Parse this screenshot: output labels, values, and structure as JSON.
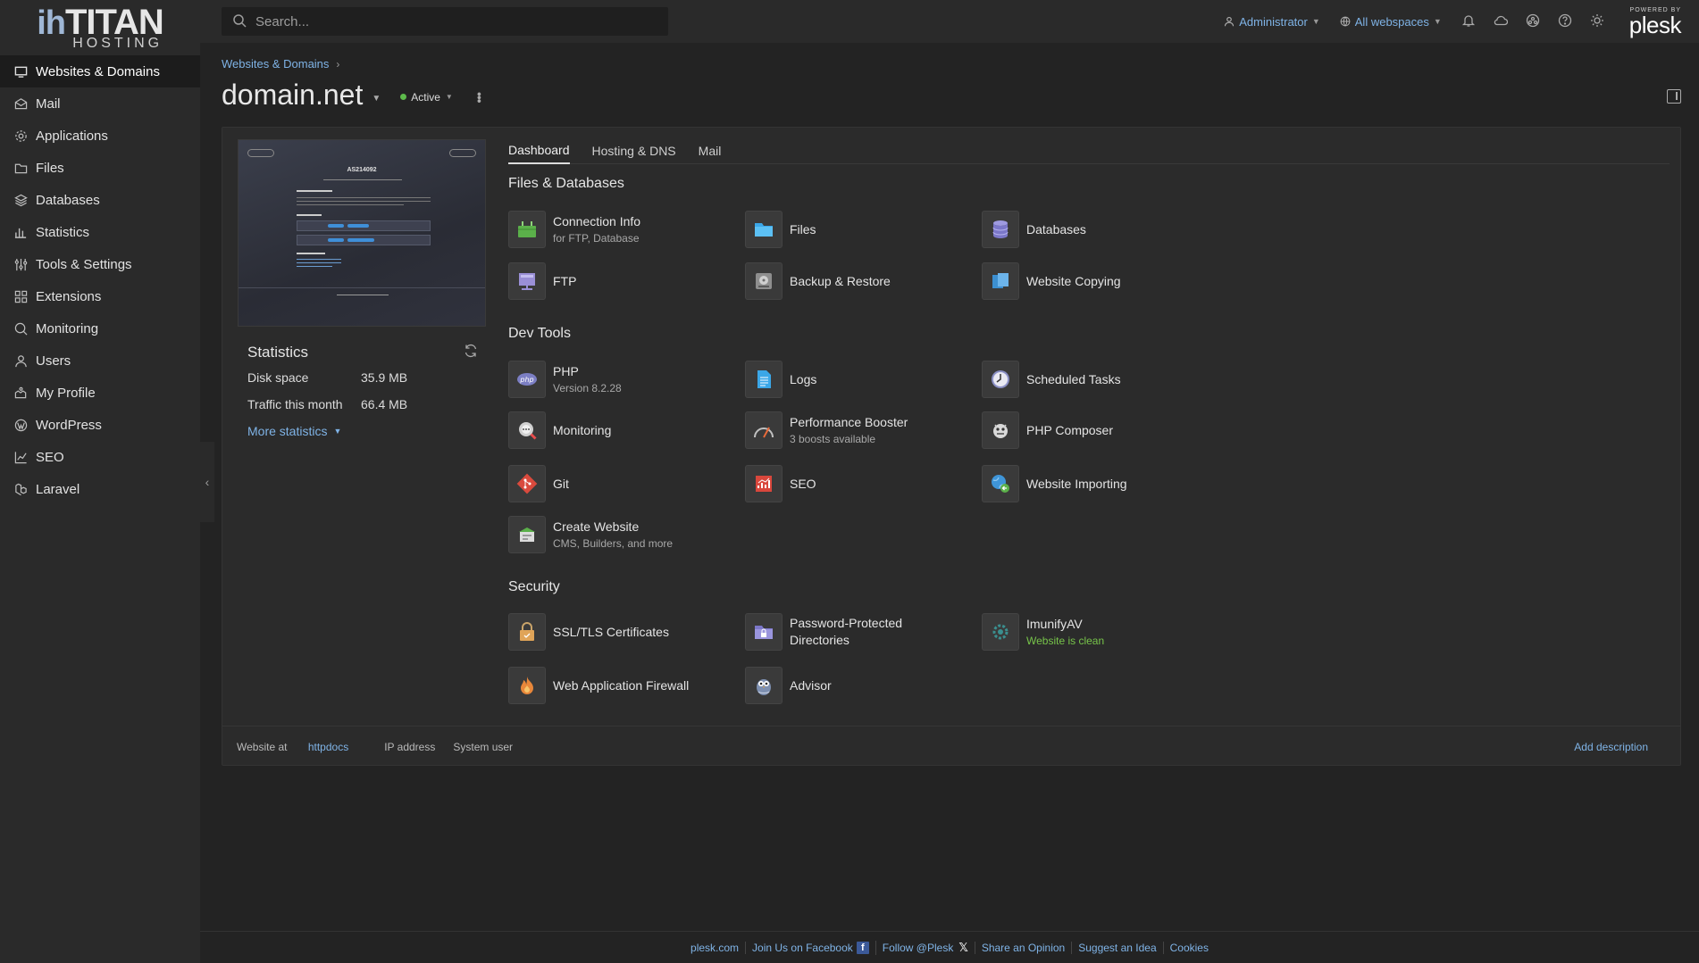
{
  "brand": {
    "logo_main": "ihTITAN",
    "logo_prefix": "ih",
    "logo_word": "TITAN",
    "logo_sub": "HOSTING"
  },
  "search": {
    "placeholder": "Search..."
  },
  "topbar": {
    "user": "Administrator",
    "webspaces": "All webspaces",
    "powered_by": "POWERED BY",
    "plesk": "plesk",
    "icons": [
      "notifications-icon",
      "cloud-icon",
      "community-icon",
      "help-icon",
      "theme-icon"
    ]
  },
  "sidebar": {
    "items": [
      {
        "label": "Websites & Domains",
        "icon": "monitor-icon"
      },
      {
        "label": "Mail",
        "icon": "mail-icon"
      },
      {
        "label": "Applications",
        "icon": "gear-icon"
      },
      {
        "label": "Files",
        "icon": "folder-icon"
      },
      {
        "label": "Databases",
        "icon": "layers-icon"
      },
      {
        "label": "Statistics",
        "icon": "bar-chart-icon"
      },
      {
        "label": "Tools & Settings",
        "icon": "sliders-icon"
      },
      {
        "label": "Extensions",
        "icon": "grid-icon"
      },
      {
        "label": "Monitoring",
        "icon": "monitoring-icon"
      },
      {
        "label": "Users",
        "icon": "user-icon"
      },
      {
        "label": "My Profile",
        "icon": "profile-icon"
      },
      {
        "label": "WordPress",
        "icon": "wordpress-icon"
      },
      {
        "label": "SEO",
        "icon": "seo-icon"
      },
      {
        "label": "Laravel",
        "icon": "laravel-icon"
      }
    ]
  },
  "breadcrumb": {
    "root": "Websites & Domains"
  },
  "domain": {
    "name": "domain.net",
    "status": "Active",
    "status_color": "#5dba4b"
  },
  "preview": {
    "heading": "AS214092"
  },
  "stats": {
    "title": "Statistics",
    "disk_label": "Disk space",
    "disk_value": "35.9 MB",
    "traffic_label": "Traffic this month",
    "traffic_value": "66.4 MB",
    "more": "More statistics"
  },
  "tabs": [
    "Dashboard",
    "Hosting & DNS",
    "Mail"
  ],
  "sections": {
    "files_db": "Files & Databases",
    "dev_tools": "Dev Tools",
    "security": "Security"
  },
  "tiles": {
    "connection": {
      "label": "Connection Info",
      "sub": "for FTP, Database"
    },
    "files": {
      "label": "Files"
    },
    "databases": {
      "label": "Databases"
    },
    "ftp": {
      "label": "FTP"
    },
    "backup": {
      "label": "Backup & Restore"
    },
    "copying": {
      "label": "Website Copying"
    },
    "php": {
      "label": "PHP",
      "sub": "Version 8.2.28"
    },
    "logs": {
      "label": "Logs"
    },
    "scheduled": {
      "label": "Scheduled Tasks"
    },
    "monitoring": {
      "label": "Monitoring"
    },
    "booster": {
      "label": "Performance Booster",
      "sub": "3 boosts available"
    },
    "composer": {
      "label": "PHP Composer"
    },
    "git": {
      "label": "Git"
    },
    "seo": {
      "label": "SEO"
    },
    "importing": {
      "label": "Website Importing"
    },
    "create": {
      "label": "Create Website",
      "sub": "CMS, Builders, and more"
    },
    "ssl": {
      "label": "SSL/TLS Certificates"
    },
    "password": {
      "label": "Password-Protected Directories"
    },
    "imunify": {
      "label": "ImunifyAV",
      "sub": "Website is clean"
    },
    "waf": {
      "label": "Web Application Firewall"
    },
    "advisor": {
      "label": "Advisor"
    }
  },
  "card_footer": {
    "website_at": "Website at",
    "httpdocs": "httpdocs",
    "ip": "IP address",
    "sysuser": "System user",
    "add_description": "Add description"
  },
  "page_footer": {
    "plesk_com": "plesk.com",
    "facebook": "Join Us on Facebook",
    "follow": "Follow @Plesk",
    "opinion": "Share an Opinion",
    "idea": "Suggest an Idea",
    "cookies": "Cookies"
  }
}
